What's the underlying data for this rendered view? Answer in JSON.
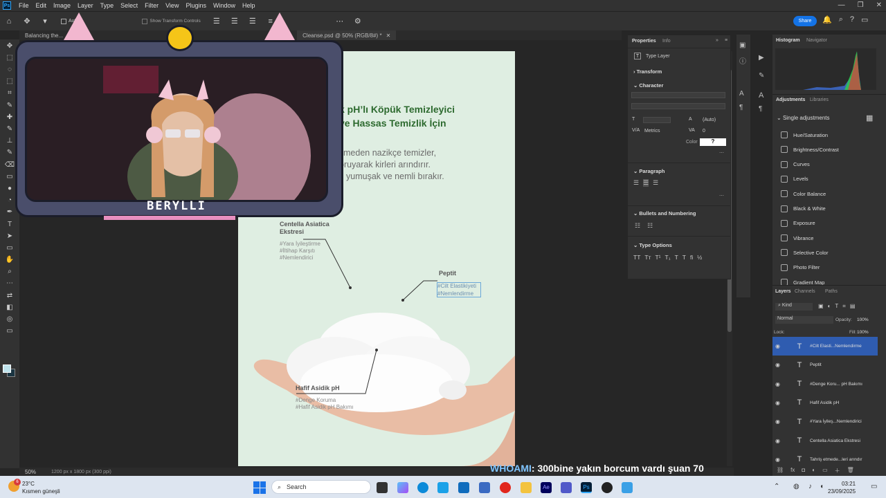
{
  "app": {
    "logo": "Ps",
    "menu": [
      "File",
      "Edit",
      "Image",
      "Layer",
      "Type",
      "Select",
      "Filter",
      "View",
      "Plugins",
      "Window",
      "Help"
    ],
    "window_controls": [
      "—",
      "❐",
      "✕"
    ]
  },
  "options_bar": {
    "auto_select_label": "Auto",
    "show_transform_label": "Show Transform Controls",
    "share_label": "Share"
  },
  "tabs": [
    {
      "label": "Balancing the..."
    },
    {
      "label": "Cleanse.psd @ 50% (RGB/8#) *"
    }
  ],
  "artboard": {
    "headline_1": "k pH’lı Köpük Temizleyici",
    "headline_2": "ve Hassas Temizlik İçin",
    "body_1": "meden nazikçe temizler,",
    "body_2": "oruyarak kirleri arındırır.",
    "body_3": "yumuşak ve nemli bırakır.",
    "labels": {
      "centella_title": "Centella Asiatica\nEkstresi",
      "centella_tag_1": "#Yara İyileştirme",
      "centella_tag_2": "#İltihap Karşıtı",
      "centella_tag_3": "#Nemlendirici",
      "peptit_title": "Peptit",
      "peptit_tag_1": "#Cilt Elastikiyeti",
      "peptit_tag_2": "#Nemlendirme",
      "hafif_title": "Hafif Asidik pH",
      "hafif_tag_1": "#Denge Koruma",
      "hafif_tag_2": "#Hafif Asidik pH Bakımı"
    }
  },
  "status": {
    "zoom": "50%",
    "doc_info": "1200 px x 1800 px (300 ppi)"
  },
  "properties": {
    "tab_properties": "Properties",
    "tab_info": "Info",
    "type_layer": "Type Layer",
    "transform": "Transform",
    "character": "Character",
    "leading": "(Auto)",
    "kerning": "Metrics",
    "tracking": "0",
    "color_label": "Color",
    "color_value": "?",
    "paragraph": "Paragraph",
    "bullets": "Bullets and Numbering",
    "type_options": "Type Options"
  },
  "histogram": {
    "tab_histogram": "Histogram",
    "tab_navigator": "Navigator"
  },
  "adjustments": {
    "tab_adjustments": "Adjustments",
    "tab_libraries": "Libraries",
    "section": "Single adjustments",
    "items": [
      "Hue/Saturation",
      "Brightness/Contrast",
      "Curves",
      "Levels",
      "Color Balance",
      "Black & White",
      "Exposure",
      "Vibrance",
      "Selective Color",
      "Photo Filter",
      "Gradient Map"
    ]
  },
  "layers": {
    "tab_layers": "Layers",
    "tab_channels": "Channels",
    "tab_paths": "Paths",
    "filter_kind": "Kind",
    "blend_mode": "Normal",
    "opacity_label": "Opacity:",
    "opacity_value": "100%",
    "lock_label": "Lock:",
    "fill_label": "Fill:",
    "fill_value": "100%",
    "items": [
      {
        "name": "#Cilt Elasti...Nemlendirme",
        "active": true
      },
      {
        "name": "Peptit",
        "active": false
      },
      {
        "name": "#Denge Koru... pH Bakımı",
        "active": false
      },
      {
        "name": "Hafif Asidik pH",
        "active": false
      },
      {
        "name": "#Yara İyileş...Nemlendirici",
        "active": false
      },
      {
        "name": "Centella Asiatica  Ekstresi",
        "active": false
      },
      {
        "name": "Tahriş etmede...leri arındır",
        "active": false
      }
    ]
  },
  "overlay": {
    "streamer_name": "BERYLLI"
  },
  "ticker": {
    "who": "WHOAMI",
    "message": ": 300bine yakın borcum vardı şuan 70"
  },
  "taskbar": {
    "weather_temp": "23°C",
    "weather_desc": "Kısmen güneşli",
    "weather_badge": "6",
    "search_placeholder": "Search",
    "time": "03:21",
    "date": "23/09/2025"
  }
}
